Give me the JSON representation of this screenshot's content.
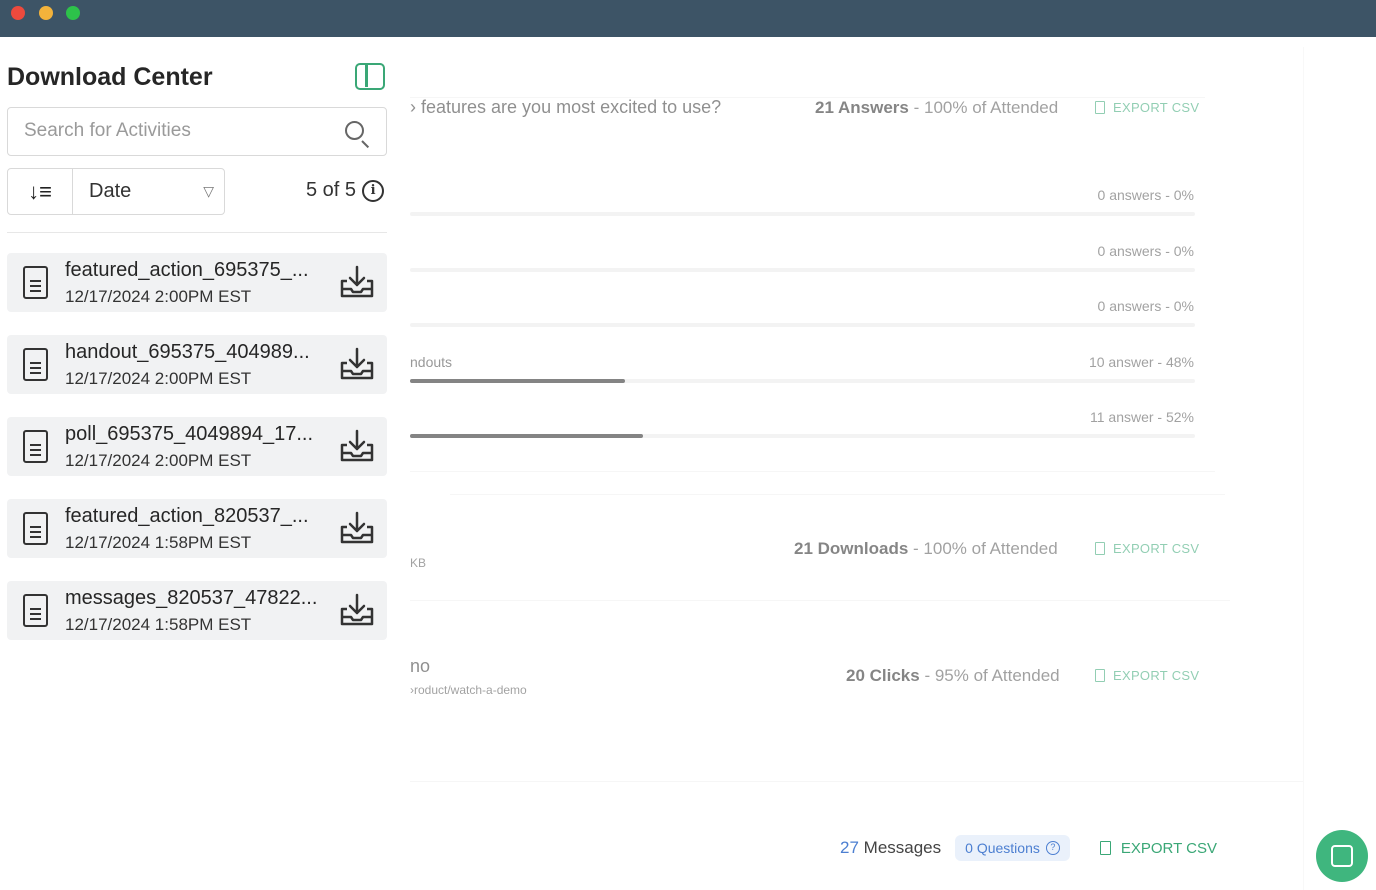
{
  "window": {
    "controls": [
      "close",
      "minimize",
      "maximize"
    ]
  },
  "main": {
    "poll": {
      "question": "› features are you most excited to use?",
      "answers_count": "21 Answers",
      "answers_pct": "- 100% of Attended",
      "export_label": "EXPORT CSV",
      "options": [
        {
          "label": "",
          "result": "0 answers - 0%",
          "fraction": 0.0
        },
        {
          "label": "",
          "result": "0 answers - 0%",
          "fraction": 0.0
        },
        {
          "label": "",
          "result": "0 answers - 0%",
          "fraction": 0.0
        },
        {
          "label": "ndouts",
          "result": "10 answer - 48%",
          "fraction": 0.48
        },
        {
          "label": "",
          "result": "11 answer - 52%",
          "fraction": 0.52
        }
      ]
    },
    "handout": {
      "size": "KB",
      "downloads_count": "21 Downloads",
      "downloads_pct": "- 100% of Attended",
      "export_label": "EXPORT CSV"
    },
    "featured_action": {
      "title": "no",
      "url": "›roduct/watch-a-demo",
      "clicks_count": "20 Clicks",
      "clicks_pct": "- 95% of Attended",
      "export_label": "EXPORT CSV"
    },
    "footer": {
      "messages_num": "27",
      "messages_label": "Messages",
      "questions_label": "0 Questions",
      "export_label": "EXPORT CSV"
    }
  },
  "sidebar": {
    "title": "Download Center",
    "search": {
      "placeholder": "Search for Activities",
      "value": ""
    },
    "sort": {
      "selected": "Date"
    },
    "count": "5 of 5",
    "items": [
      {
        "name": "featured_action_695375_...",
        "date": "12/17/2024 2:00PM EST"
      },
      {
        "name": "handout_695375_404989...",
        "date": "12/17/2024 2:00PM EST"
      },
      {
        "name": "poll_695375_4049894_17...",
        "date": "12/17/2024 2:00PM EST"
      },
      {
        "name": "featured_action_820537_...",
        "date": "12/17/2024 1:58PM EST"
      },
      {
        "name": "messages_820537_47822...",
        "date": "12/17/2024 1:58PM EST"
      }
    ]
  },
  "colors": {
    "accent": "#3aa776",
    "titlebar": "#3d5466",
    "link_blue": "#4c7fd1"
  },
  "icons": [
    "panel-toggle-icon",
    "search-icon",
    "sort-icon",
    "chevron-down-icon",
    "info-icon",
    "document-icon",
    "download-icon",
    "file-icon",
    "question-icon",
    "chat-icon"
  ]
}
